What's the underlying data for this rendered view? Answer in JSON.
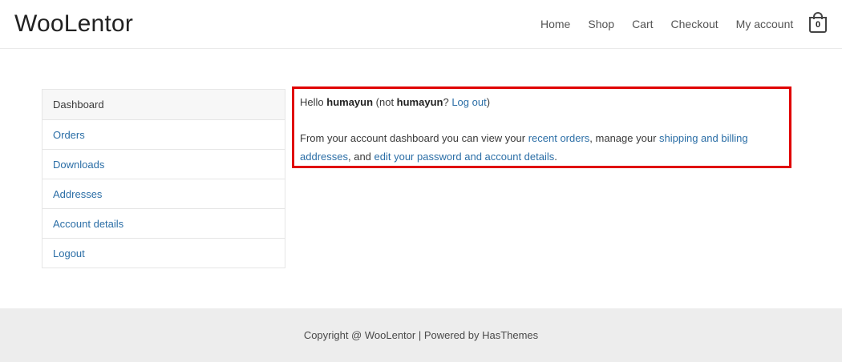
{
  "site": {
    "logo": "WooLentor"
  },
  "nav": {
    "items": [
      "Home",
      "Shop",
      "Cart",
      "Checkout",
      "My account"
    ]
  },
  "cart": {
    "count": "0"
  },
  "sidebar": {
    "items": [
      {
        "label": "Dashboard",
        "active": true
      },
      {
        "label": "Orders"
      },
      {
        "label": "Downloads"
      },
      {
        "label": "Addresses"
      },
      {
        "label": "Account details"
      },
      {
        "label": "Logout"
      }
    ]
  },
  "dashboard": {
    "hello": "Hello ",
    "username": "humayun",
    "not_open": " (not ",
    "username2": "humayun",
    "question": "? ",
    "logout_link": "Log out",
    "close_paren": ")",
    "intro": "From your account dashboard you can view your ",
    "recent_orders_link": "recent orders",
    "manage": ", manage your ",
    "addresses_link": "shipping and billing addresses",
    "and": ", and ",
    "edit_link": "edit your password and account details",
    "period": "."
  },
  "footer": {
    "text": "Copyright @ WooLentor | Powered by HasThemes"
  },
  "colors": {
    "link": "#2b6ea6",
    "highlight_border": "#e00000",
    "footer_bg": "#ededed"
  }
}
